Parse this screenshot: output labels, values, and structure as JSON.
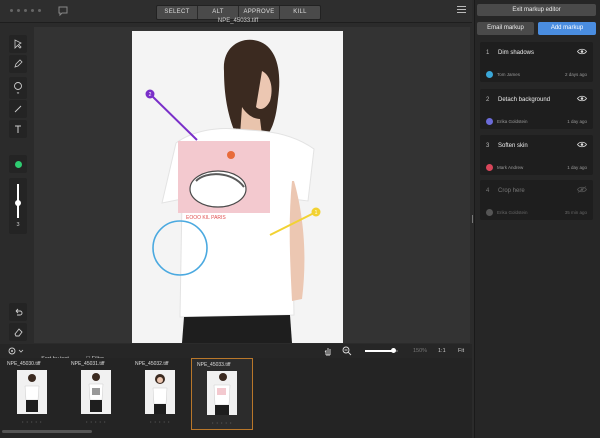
{
  "toolbar": {
    "tabs": [
      "SELECT",
      "ALT",
      "APPROVE",
      "KILL"
    ]
  },
  "canvas": {
    "filename": "NPE_45033.tiff",
    "markers": [
      "2",
      "1"
    ]
  },
  "left_tools": {
    "brush_size": "3"
  },
  "bottom_bar": {
    "sort_label": "Sort by text",
    "filter_label": "Filter",
    "zoom_percent": "150%",
    "zoom_ratio": "1:1",
    "fit_label": "Fit",
    "zoom_level": 0.85
  },
  "filmstrip": {
    "items": [
      {
        "label": "NPE_45030.tiff",
        "stars": "• • • • •"
      },
      {
        "label": "NPE_45031.tiff",
        "stars": "• • • • •"
      },
      {
        "label": "NPE_45032.tiff",
        "stars": "• • • • •"
      },
      {
        "label": "NPE_45033.tiff",
        "stars": "• • • • •"
      }
    ]
  },
  "markup_panel": {
    "exit_label": "Exit markup editor",
    "email_label": "Email markup",
    "add_label": "Add markup",
    "items": [
      {
        "num": "1",
        "title": "Dim shadows",
        "author": "Tom James",
        "time": "2 days ago",
        "avatar_color": "#3aa7d8",
        "avatar_letter": "T"
      },
      {
        "num": "2",
        "title": "Detach background",
        "author": "Erika Goldstein",
        "time": "1 day ago",
        "avatar_color": "#6b6bd8",
        "avatar_letter": "E"
      },
      {
        "num": "3",
        "title": "Soften skin",
        "author": "Mark Andrew",
        "time": "1 day ago",
        "avatar_color": "#d8465a",
        "avatar_letter": "M"
      },
      {
        "num": "4",
        "title": "Crop here",
        "author": "Erika Goldstein",
        "time": "35 min ago",
        "avatar_color": "#555555",
        "avatar_letter": "E"
      }
    ]
  },
  "colors": {
    "accent": "#4a8de0",
    "marker_purple": "#7a2fc9",
    "marker_yellow": "#f2d232",
    "circle_blue": "#4aa9e0",
    "tool_green": "#2ecc71",
    "selected_thumb_border": "#b9772a"
  }
}
